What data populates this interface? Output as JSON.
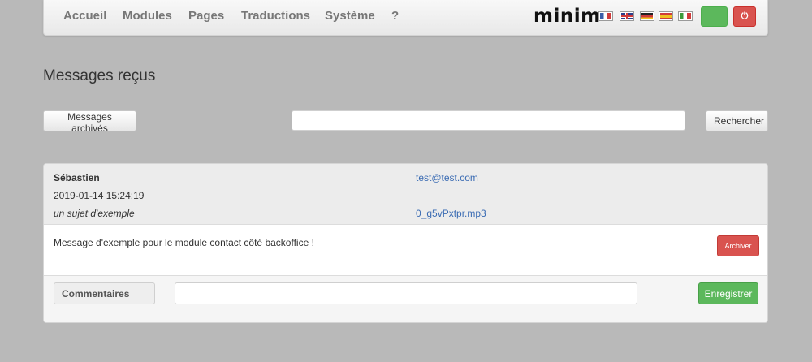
{
  "nav": {
    "items": [
      "Accueil",
      "Modules",
      "Pages",
      "Traductions",
      "Système",
      "?"
    ],
    "logo": "minim",
    "flags": [
      {
        "lang": "fr",
        "colors": [
          "#3b5ea8",
          "#ffffff",
          "#cf3b3b"
        ]
      },
      {
        "lang": "en",
        "colors": [
          "#2b3f8c",
          "#ffffff",
          "#cf3b3b"
        ]
      },
      {
        "lang": "de",
        "colors": [
          "#222222",
          "#cf3b3b",
          "#f0c020"
        ]
      },
      {
        "lang": "es",
        "colors": [
          "#cf3b3b",
          "#f0c020",
          "#cf3b3b"
        ]
      },
      {
        "lang": "it",
        "colors": [
          "#3a9a3a",
          "#ffffff",
          "#cf3b3b"
        ]
      }
    ],
    "power_icon": "power-icon",
    "power_glyph": "⏻"
  },
  "page": {
    "title": "Messages reçus"
  },
  "toolbar": {
    "archived_label": "Messages archivés",
    "search_value": "",
    "search_label": "Rechercher"
  },
  "message": {
    "sender": "Sébastien",
    "email": "test@test.com",
    "date": "2019-01-14 15:24:19",
    "subject": "un sujet d'exemple",
    "attachment": "0_g5vPxtpr.mp3",
    "body": "Message d'exemple pour le module contact côté backoffice !",
    "archive_label": "Archiver",
    "comments_label": "Commentaires",
    "comment_value": "",
    "save_label": "Enregistrer"
  },
  "colors": {
    "background": "#b9b9b9",
    "success": "#5cb85c",
    "danger": "#d9534f",
    "link": "#3a6bb3"
  }
}
